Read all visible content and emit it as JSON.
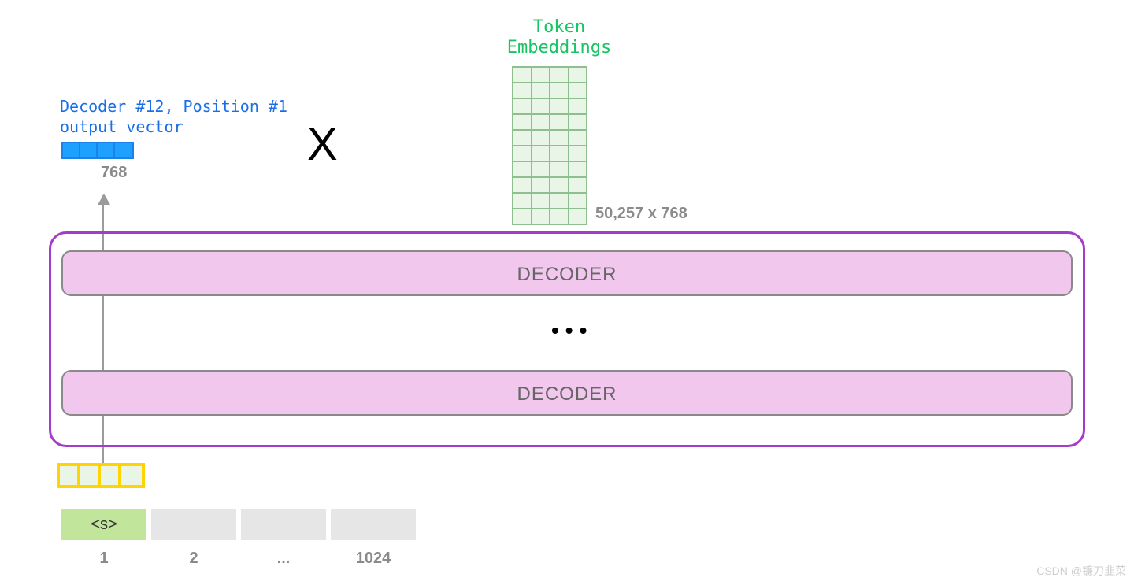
{
  "embeddings": {
    "title_line1": "Token",
    "title_line2": "Embeddings",
    "rows": 10,
    "cols": 4,
    "dims_label": "50,257 x 768"
  },
  "output_vector": {
    "label_line1": "Decoder #12, Position #1",
    "label_line2": "output vector",
    "cells": 4,
    "dim_label": "768"
  },
  "multiply_symbol": "X",
  "decoder_stack": {
    "top_label": "DECODER",
    "bottom_label": "DECODER",
    "dots": "•••"
  },
  "input_vector": {
    "cells": 4
  },
  "tokens": [
    "<s>",
    "",
    "",
    ""
  ],
  "positions": [
    "1",
    "2",
    "...",
    "1024"
  ],
  "watermark": "CSDN @镰刀韭菜"
}
